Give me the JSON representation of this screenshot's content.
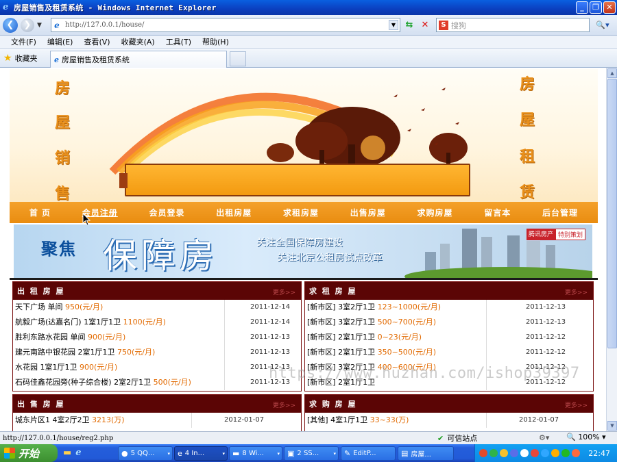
{
  "window": {
    "title": "房屋销售及租赁系统 - Windows Internet Explorer"
  },
  "toolbar": {
    "url": "http://127.0.0.1/house/",
    "search_placeholder": "搜狗"
  },
  "menu": [
    "文件(F)",
    "编辑(E)",
    "查看(V)",
    "收藏夹(A)",
    "工具(T)",
    "帮助(H)"
  ],
  "favorites": {
    "label": "收藏夹",
    "tab_title": "房屋销售及租赁系统"
  },
  "banner": {
    "left_chars": [
      "房",
      "屋",
      "销",
      "售"
    ],
    "right_chars": [
      "房",
      "屋",
      "租",
      "赁"
    ]
  },
  "nav": [
    "首 页",
    "会员注册",
    "会员登录",
    "出租房屋",
    "求租房屋",
    "出售房屋",
    "求购房屋",
    "留言本",
    "后台管理"
  ],
  "promo": {
    "focus": "聚焦",
    "title": "保障房",
    "line1": "关注全国保障房建设",
    "line2": "关注北京公租房试点改革",
    "badge1": "腾讯房产",
    "badge2": "特别策划"
  },
  "panels": {
    "rent_out": {
      "title": "出 租 房 屋",
      "more": "更多>>",
      "rows": [
        {
          "name": "天下广场 单间",
          "price": "950(元/月)",
          "date": "2011-12-14"
        },
        {
          "name": "航毅广场(达嘉名门) 1室1厅1卫",
          "price": "1100(元/月)",
          "date": "2011-12-14"
        },
        {
          "name": "胜利东路水花园 单间",
          "price": "900(元/月)",
          "date": "2011-12-13"
        },
        {
          "name": "建元南路中银花园 2室1厅1卫",
          "price": "750(元/月)",
          "date": "2011-12-13"
        },
        {
          "name": "水花园 1室1厅1卫",
          "price": "900(元/月)",
          "date": "2011-12-13"
        },
        {
          "name": "石码佳鑫花园旁(种子综合楼) 2室2厅1卫",
          "price": "500(元/月)",
          "date": "2011-12-13"
        }
      ]
    },
    "rent_want": {
      "title": "求 租 房 屋",
      "more": "更多>>",
      "rows": [
        {
          "name": "[新市区] 3室2厅1卫",
          "price": "123~1000(元/月)",
          "date": "2011-12-13"
        },
        {
          "name": "[新市区] 3室2厅1卫",
          "price": "500~700(元/月)",
          "date": "2011-12-13"
        },
        {
          "name": "[新市区] 2室1厅1卫",
          "price": "0~23(元/月)",
          "date": "2011-12-12"
        },
        {
          "name": "[新市区] 2室1厅1卫",
          "price": "350~500(元/月)",
          "date": "2011-12-12"
        },
        {
          "name": "[新市区] 3室2厅1卫",
          "price": "400~600(元/月)",
          "date": "2011-12-12"
        },
        {
          "name": "[新市区] 2室1厅1卫",
          "price": "",
          "date": "2011-12-12"
        }
      ]
    },
    "sell": {
      "title": "出 售 房 屋",
      "more": "更多>>",
      "rows": [
        {
          "name": "城东片区1 4室2厅2卫",
          "price": "3213(万)",
          "date": "2012-01-07"
        }
      ]
    },
    "buy": {
      "title": "求 购 房 屋",
      "more": "更多>>",
      "rows": [
        {
          "name": "[其他] 4室1厅1卫",
          "price": "33~33(万)",
          "date": "2012-01-07"
        }
      ]
    }
  },
  "watermark": "https://www.huzhan.com/ishop39397",
  "status": {
    "url": "http://127.0.0.1/house/reg2.php",
    "trust": "可信站点",
    "zoom": "100%"
  },
  "taskbar": {
    "start": "开始",
    "items": [
      "5 QQ...",
      "4 In...",
      "8 Wi...",
      "2 SS...",
      "EditP...",
      "房屋..."
    ],
    "clock": "22:47"
  }
}
